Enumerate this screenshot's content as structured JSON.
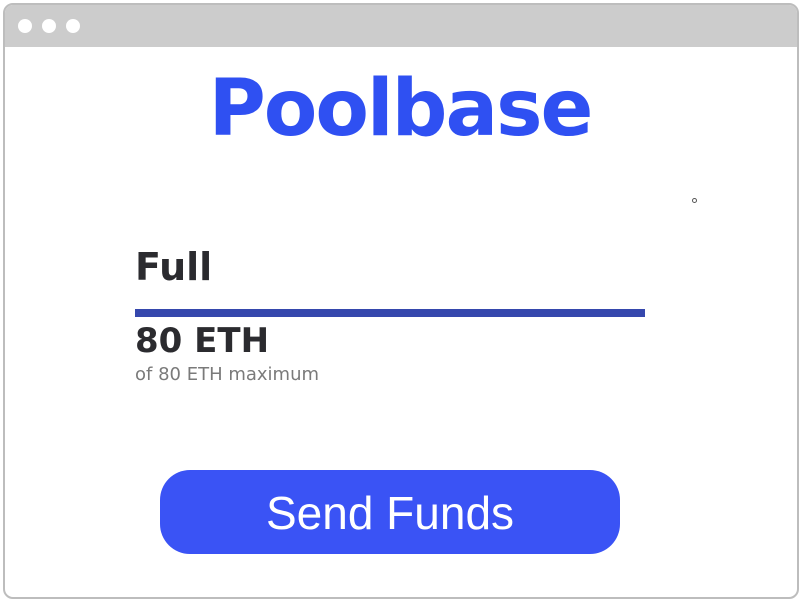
{
  "brand": {
    "logo_text": "Poolbase",
    "color": "#2f50f2"
  },
  "pool": {
    "status": "Full",
    "amount": "80 ETH",
    "maximum_text": "of 80 ETH maximum",
    "progress_fraction": 1.0,
    "progress_color": "#3547ad"
  },
  "actions": {
    "send_label": "Send Funds",
    "button_color": "#3a53f5"
  }
}
